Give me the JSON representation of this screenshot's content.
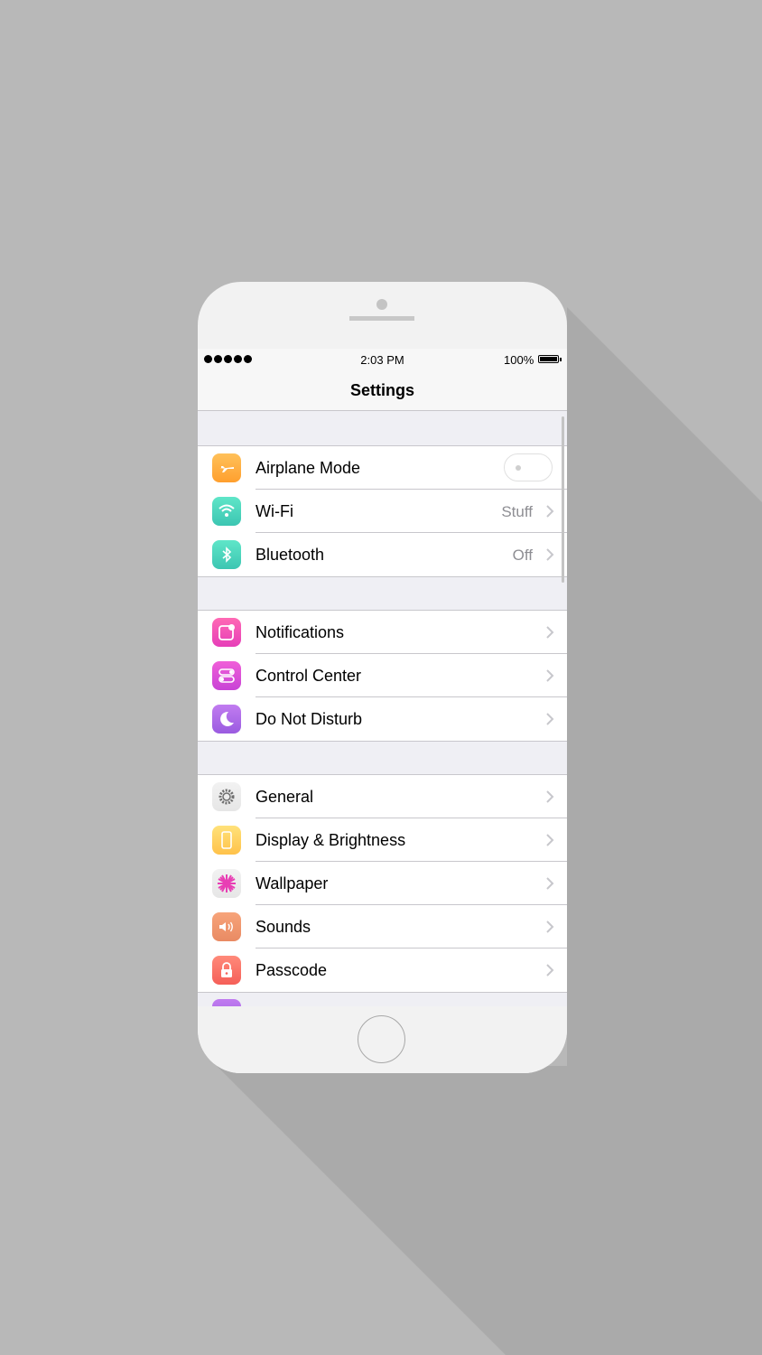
{
  "colors": {
    "background": "#b8b8b8",
    "shadow": "#aaaaaa",
    "phone_body": "#f2f2f2",
    "group_background": "#efeff4",
    "secondary_text": "#8e8e93"
  },
  "status_bar": {
    "signal_dots": 5,
    "time": "2:03 PM",
    "battery": "100%"
  },
  "nav": {
    "title": "Settings"
  },
  "groups": [
    {
      "rows": [
        {
          "label": "Airplane Mode",
          "icon": "airplane-icon",
          "accessory": "toggle",
          "toggle_on": false
        },
        {
          "label": "Wi-Fi",
          "icon": "wifi-icon",
          "value": "Stuff",
          "accessory": "chevron"
        },
        {
          "label": "Bluetooth",
          "icon": "bluetooth-icon",
          "value": "Off",
          "accessory": "chevron"
        }
      ]
    },
    {
      "rows": [
        {
          "label": "Notifications",
          "icon": "notifications-icon",
          "accessory": "chevron"
        },
        {
          "label": "Control Center",
          "icon": "control-center-icon",
          "accessory": "chevron"
        },
        {
          "label": "Do Not Disturb",
          "icon": "moon-icon",
          "accessory": "chevron"
        }
      ]
    },
    {
      "rows": [
        {
          "label": "General",
          "icon": "gear-icon",
          "accessory": "chevron"
        },
        {
          "label": "Display & Brightness",
          "icon": "display-icon",
          "accessory": "chevron"
        },
        {
          "label": "Wallpaper",
          "icon": "wallpaper-flower-icon",
          "accessory": "chevron"
        },
        {
          "label": "Sounds",
          "icon": "speaker-icon",
          "accessory": "chevron"
        },
        {
          "label": "Passcode",
          "icon": "lock-icon",
          "accessory": "chevron"
        }
      ]
    }
  ],
  "icon_colors": {
    "airplane-icon": [
      "#ffc15a",
      "#ff9f2e"
    ],
    "wifi-icon": [
      "#5fe6c8",
      "#3cc6b2"
    ],
    "bluetooth-icon": [
      "#5fe6c8",
      "#3cc6b2"
    ],
    "notifications-icon": [
      "#ff69b4",
      "#e63eb8"
    ],
    "control-center-icon": [
      "#f05fd8",
      "#c843d6"
    ],
    "moon-icon": [
      "#c17cf0",
      "#9a5be0"
    ],
    "gear-icon": [
      "#f2f2f2",
      "#e6e6e6"
    ],
    "display-icon": [
      "#ffe27a",
      "#ffc24a"
    ],
    "wallpaper-flower-icon": [
      "#f2f2f2",
      "#e6e6e6"
    ],
    "speaker-icon": [
      "#f7a47a",
      "#e98a63"
    ],
    "lock-icon": [
      "#ff8a7a",
      "#f55f58"
    ]
  }
}
